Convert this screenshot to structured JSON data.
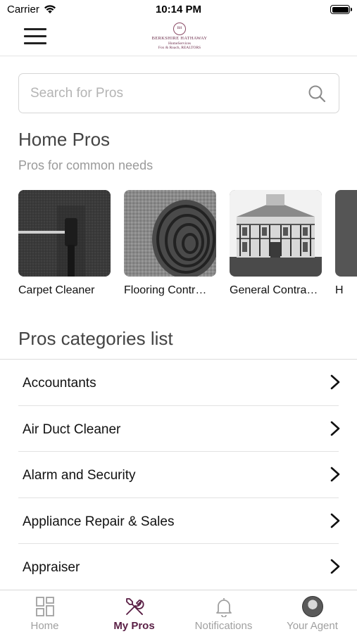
{
  "status_bar": {
    "carrier": "Carrier",
    "time": "10:14 PM"
  },
  "header": {
    "logo_line1": "BERKSHIRE HATHAWAY",
    "logo_line2": "HomeServices",
    "logo_line3": "Fox & Roach, REALTORS"
  },
  "search": {
    "placeholder": "Search for Pros",
    "value": ""
  },
  "home_pros": {
    "title": "Home Pros",
    "subtitle": "Pros for common needs",
    "cards": [
      {
        "label": "Carpet Cleaner",
        "image": "carpet-cleaner-photo"
      },
      {
        "label": "Flooring Contr…",
        "image": "rolled-carpet-photo"
      },
      {
        "label": "General Contra…",
        "image": "house-photo"
      },
      {
        "label": "H",
        "image": "partial-photo"
      }
    ]
  },
  "categories": {
    "title": "Pros categories list",
    "items": [
      {
        "label": "Accountants"
      },
      {
        "label": "Air Duct Cleaner"
      },
      {
        "label": "Alarm and Security"
      },
      {
        "label": "Appliance Repair & Sales"
      },
      {
        "label": "Appraiser"
      }
    ]
  },
  "tab_bar": {
    "tabs": [
      {
        "label": "Home",
        "icon": "grid-icon",
        "active": false
      },
      {
        "label": "My Pros",
        "icon": "tools-icon",
        "active": true
      },
      {
        "label": "Notifications",
        "icon": "bell-icon",
        "active": false
      },
      {
        "label": "Your Agent",
        "icon": "avatar",
        "active": false
      }
    ]
  },
  "colors": {
    "accent": "#5a1f45",
    "inactive": "#a0a0a0",
    "text": "#111111"
  }
}
